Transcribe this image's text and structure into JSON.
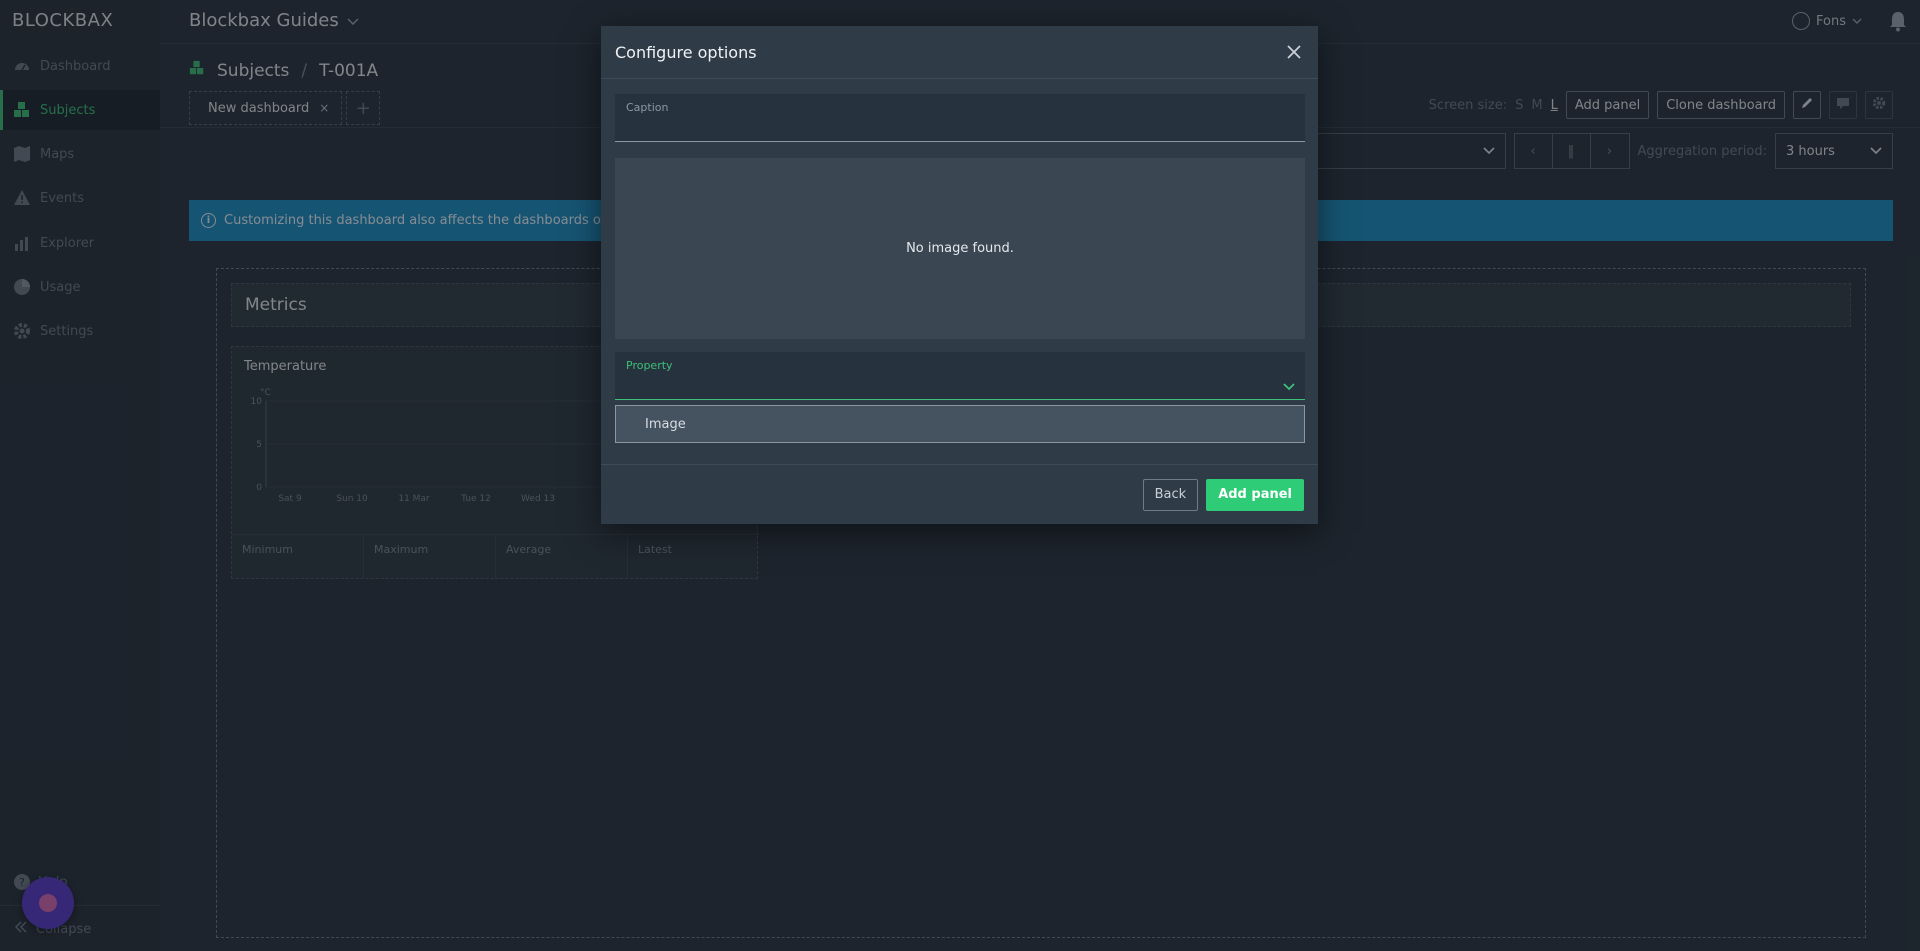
{
  "sidebar": {
    "logo": "BLOCKBAX",
    "items": [
      {
        "label": "Dashboard",
        "icon": "gauge-icon"
      },
      {
        "label": "Subjects",
        "icon": "cubes-icon"
      },
      {
        "label": "Maps",
        "icon": "map-icon"
      },
      {
        "label": "Events",
        "icon": "warning-icon"
      },
      {
        "label": "Explorer",
        "icon": "chart-icon"
      },
      {
        "label": "Usage",
        "icon": "pie-icon"
      },
      {
        "label": "Settings",
        "icon": "gear-icon"
      }
    ],
    "help_label": "Help",
    "collapse_label": "Collapse"
  },
  "topbar": {
    "app_title": "Blockbax Guides",
    "user_name": "Fons"
  },
  "breadcrumb": {
    "section": "Subjects",
    "separator": "/",
    "current": "T-001A"
  },
  "tabs": [
    {
      "label": "New dashboard",
      "close": "×"
    }
  ],
  "toolbar": {
    "screen_size_label": "Screen size:",
    "sizes": [
      "S",
      "M",
      "L"
    ],
    "selected_size": "L",
    "add_panel_label": "Add panel",
    "clone_dashboard_label": "Clone dashboard"
  },
  "controls": {
    "aggregation_label": "Aggregation period:",
    "aggregation_value": "3 hours"
  },
  "banner": {
    "text": "Customizing this dashboard also affects the dashboards of other s"
  },
  "dashboard": {
    "section_title": "Metrics",
    "panel": {
      "title": "Temperature",
      "unit": "°C",
      "stats": [
        "Minimum",
        "Maximum",
        "Average",
        "Latest"
      ]
    }
  },
  "chart_data": {
    "type": "line",
    "title": "Temperature",
    "ylabel": "°C",
    "yticks": [
      10,
      5,
      0
    ],
    "ylim": [
      0,
      10
    ],
    "x": [
      "Sat 9",
      "Sun 10",
      "11 Mar",
      "Tue 12",
      "Wed 13"
    ],
    "series": []
  },
  "modal": {
    "title": "Configure options",
    "caption_label": "Caption",
    "caption_value": "",
    "image_placeholder": "No image found.",
    "property_label": "Property",
    "property_value": "",
    "dropdown_options": [
      "Image"
    ],
    "back_label": "Back",
    "add_panel_label": "Add panel"
  },
  "colors": {
    "accent_green": "#2ecc77",
    "banner_blue": "#1f8ec4",
    "chat_purple": "#5a3ec8"
  }
}
